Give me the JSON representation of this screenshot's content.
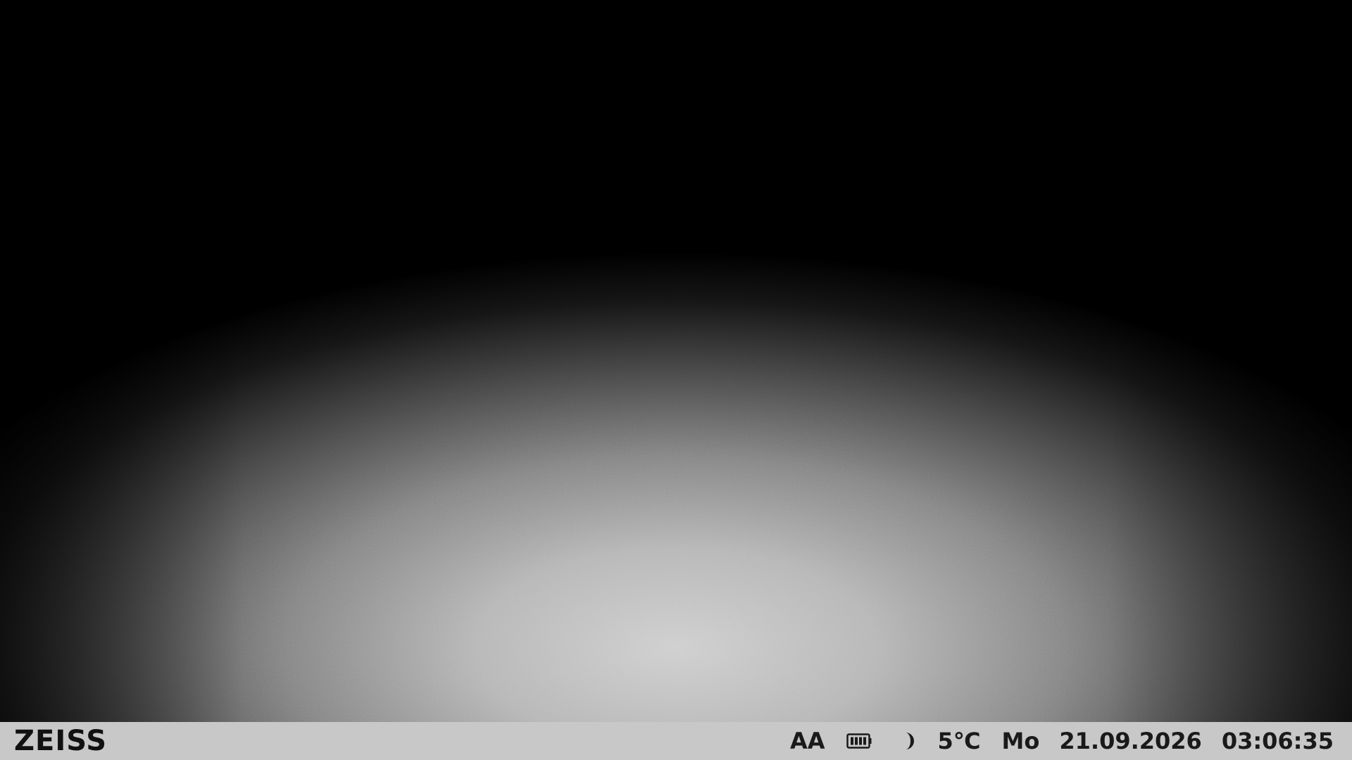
{
  "brand": {
    "name": "ZEISS"
  },
  "status": {
    "mode": "AA",
    "battery_icon": "battery-icon",
    "moon_phase_icon": "moon-icon",
    "temperature": "5℃",
    "weekday": "Mo",
    "date": "21.09.2026",
    "time": "03:06:35"
  },
  "colors": {
    "status_bar_bg": "#c8c8c8",
    "status_text": "#1a1a1a"
  }
}
